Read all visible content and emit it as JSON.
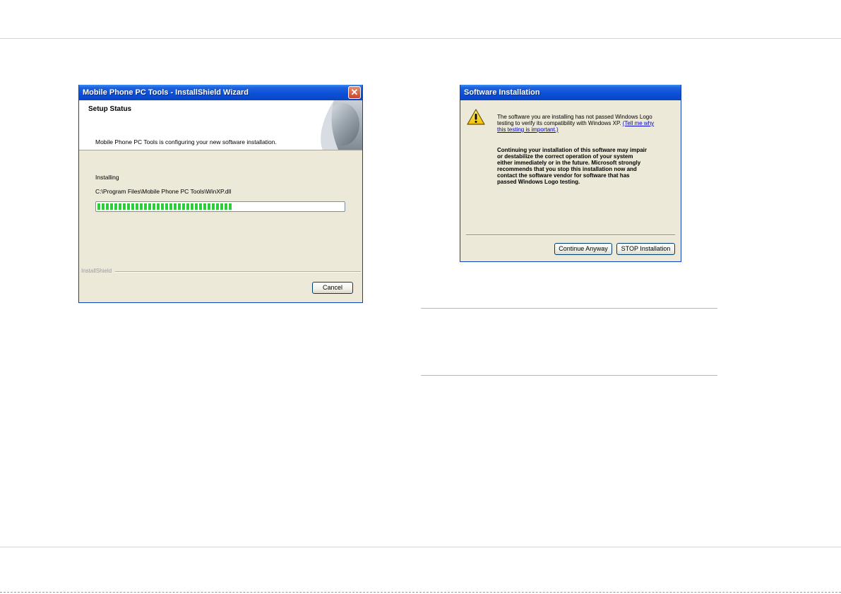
{
  "wizard": {
    "title": "Mobile Phone PC Tools - InstallShield Wizard",
    "close_glyph": "✕",
    "header_title": "Setup Status",
    "status_message": "Mobile Phone PC Tools is configuring your new software installation.",
    "action_label": "Installing",
    "current_file": "C:\\Program Files\\Mobile Phone PC Tools\\WinXP.dll",
    "progress": 0.55,
    "brand": "InstallShield",
    "cancel_label": "Cancel",
    "art_icon": "installshield-page-curl-icon"
  },
  "dialog": {
    "title": "Software Installation",
    "icon": "warning-icon",
    "message_line1": "The software you are installing has not passed Windows Logo",
    "message_line2_prefix": "testing to verify its compatibility with Windows XP. ",
    "link_part1": "(Tell me why",
    "link_part2": "this testing is important.)",
    "warning_lines": [
      "Continuing your installation of this software may impair",
      "or destabilize the correct operation of your system",
      "either immediately or in the future. Microsoft strongly",
      "recommends that you stop this installation now and",
      "contact the software vendor for software that has",
      "passed Windows Logo testing."
    ],
    "continue_label": "Continue Anyway",
    "stop_label": "STOP Installation"
  },
  "colors": {
    "title_bar": "#0b4fd6",
    "window_face": "#ece9d8",
    "progress_fill": "#2ecb3a",
    "link": "#0000cc"
  }
}
